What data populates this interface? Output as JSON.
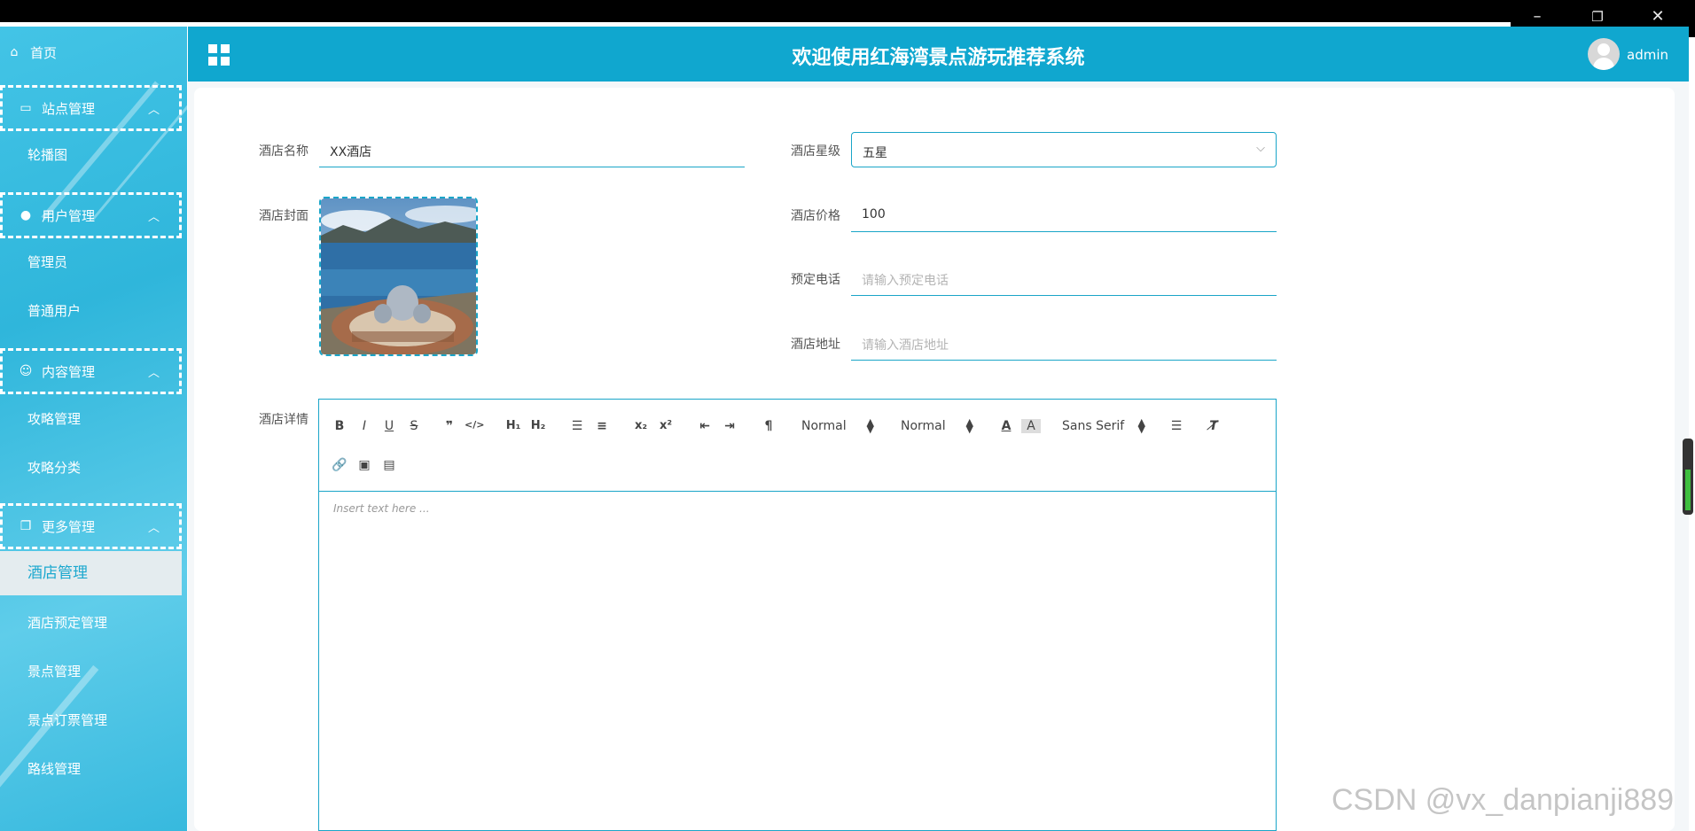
{
  "window": {
    "minimize": "–",
    "restore": "❐",
    "close": "✕"
  },
  "header": {
    "title": "欢迎使用红海湾景点游玩推荐系统",
    "username": "admin"
  },
  "sidebar": {
    "home": "首页",
    "groups": [
      {
        "label": "站点管理",
        "items": [
          "轮播图"
        ]
      },
      {
        "label": "用户管理",
        "items": [
          "管理员",
          "普通用户"
        ]
      },
      {
        "label": "内容管理",
        "items": [
          "攻略管理",
          "攻略分类"
        ]
      },
      {
        "label": "更多管理",
        "items": [
          "酒店管理",
          "酒店预定管理",
          "景点管理",
          "景点订票管理",
          "路线管理"
        ]
      }
    ],
    "active_item": "酒店管理"
  },
  "form": {
    "name": {
      "label": "酒店名称",
      "value": "XX酒店"
    },
    "star": {
      "label": "酒店星级",
      "value": "五星"
    },
    "cover": {
      "label": "酒店封面"
    },
    "price": {
      "label": "酒店价格",
      "value": "100"
    },
    "phone": {
      "label": "预定电话",
      "placeholder": "请输入预定电话"
    },
    "address": {
      "label": "酒店地址",
      "placeholder": "请输入酒店地址"
    },
    "detail": {
      "label": "酒店详情"
    }
  },
  "editor": {
    "header_select": "Normal",
    "size_select": "Normal",
    "font_select": "Sans Serif",
    "placeholder": "Insert text here ..."
  },
  "watermark": "CSDN @vx_danpianji889"
}
